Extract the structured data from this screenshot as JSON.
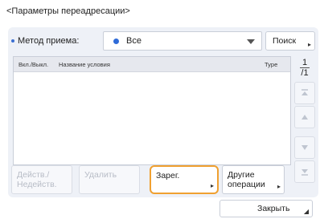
{
  "title": "<Параметры переадресации>",
  "method": {
    "label": "Метод приема:",
    "selected": "Все",
    "search_label": "Поиск"
  },
  "list": {
    "columns": [
      "Вкл./Выкл.",
      "Название условия",
      "Type"
    ]
  },
  "pager": {
    "current": "1",
    "total": "/1"
  },
  "buttons": {
    "toggle_line1": "Действ./",
    "toggle_line2": "Недейств.",
    "delete": "Удалить",
    "register": "Зарег.",
    "other_line1": "Другие",
    "other_line2": "операции"
  },
  "close_label": "Закрыть",
  "colors": {
    "accent": "#3b6fd1",
    "focus": "#f0a030"
  }
}
